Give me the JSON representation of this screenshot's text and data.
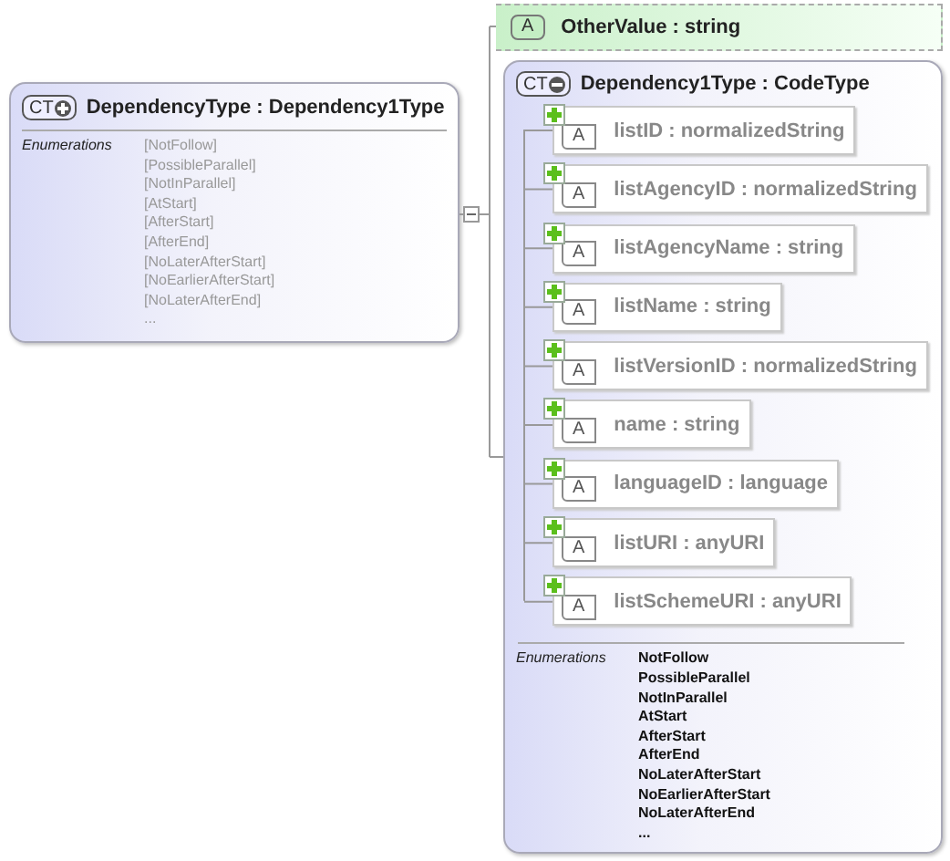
{
  "root": {
    "badge": "CT",
    "expanded": false,
    "title": "DependencyType : Dependency1Type",
    "enum_label": "Enumerations",
    "values": [
      "[NotFollow]",
      "[PossibleParallel]",
      "[NotInParallel]",
      "[AtStart]",
      "[AfterStart]",
      "[AfterEnd]",
      "[NoLaterAfterStart]",
      "[NoEarlierAfterStart]",
      "[NoLaterAfterEnd]",
      "..."
    ]
  },
  "attribute": {
    "badge": "A",
    "title": "OtherValue : string"
  },
  "complex_type": {
    "badge": "CT",
    "expanded": true,
    "title": "Dependency1Type : CodeType",
    "attributes": [
      {
        "badge": "A",
        "label": "listID : normalizedString"
      },
      {
        "badge": "A",
        "label": "listAgencyID : normalizedString"
      },
      {
        "badge": "A",
        "label": "listAgencyName : string"
      },
      {
        "badge": "A",
        "label": "listName : string"
      },
      {
        "badge": "A",
        "label": "listVersionID : normalizedString"
      },
      {
        "badge": "A",
        "label": "name : string"
      },
      {
        "badge": "A",
        "label": "languageID : language"
      },
      {
        "badge": "A",
        "label": "listURI : anyURI"
      },
      {
        "badge": "A",
        "label": "listSchemeURI : anyURI"
      }
    ],
    "enum_label": "Enumerations",
    "values": [
      "NotFollow",
      "PossibleParallel",
      "NotInParallel",
      "AtStart",
      "AfterStart",
      "AfterEnd",
      "NoLaterAfterStart",
      "NoEarlierAfterStart",
      "NoLaterAfterEnd",
      "..."
    ]
  }
}
